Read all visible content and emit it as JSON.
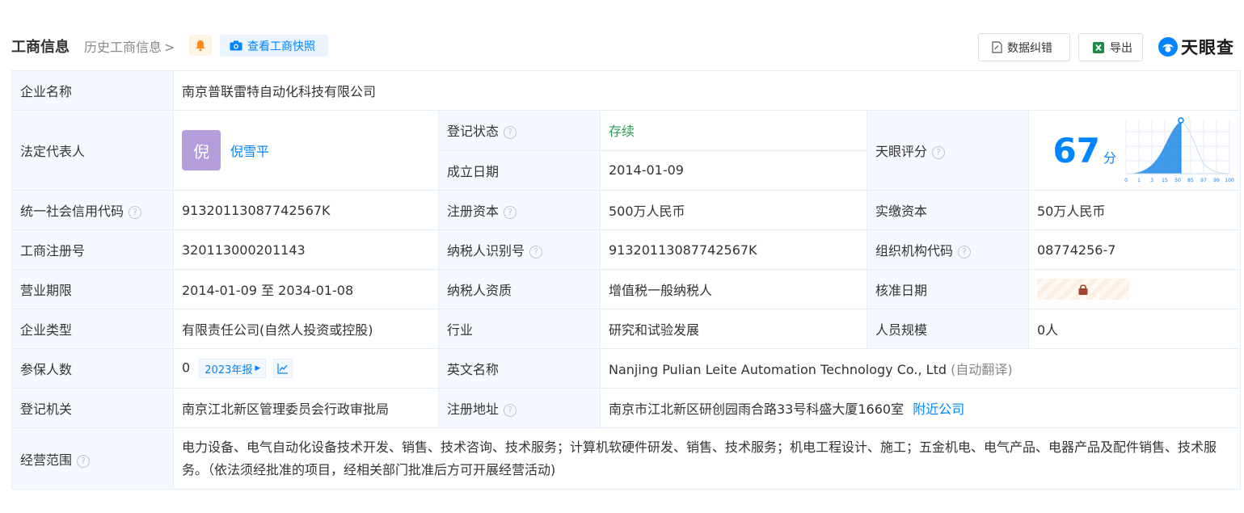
{
  "header": {
    "title": "工商信息",
    "history": "历史工商信息",
    "snapshot_btn": "查看工商快照",
    "fix_btn": "数据纠错",
    "export_btn": "导出",
    "brand": "天眼查"
  },
  "rows": {
    "company_name": {
      "label": "企业名称",
      "value": "南京普联雷特自动化科技有限公司"
    },
    "legal_rep": {
      "label": "法定代表人",
      "avatar": "倪",
      "name": "倪雪平"
    },
    "reg_status": {
      "label": "登记状态",
      "value": "存续"
    },
    "found_date": {
      "label": "成立日期",
      "value": "2014-01-09"
    },
    "tianyan_score": {
      "label": "天眼评分",
      "score": "67",
      "unit": "分",
      "ticks": [
        "0",
        "1",
        "3",
        "15",
        "50",
        "85",
        "97",
        "99",
        "100"
      ],
      "color": "#0084ff"
    },
    "credit_code": {
      "label": "统一社会信用代码",
      "value": "91320113087742567K"
    },
    "reg_capital": {
      "label": "注册资本",
      "value": "500万人民币"
    },
    "paid_capital": {
      "label": "实缴资本",
      "value": "50万人民币"
    },
    "reg_no": {
      "label": "工商注册号",
      "value": "320113000201143"
    },
    "taxpayer_id": {
      "label": "纳税人识别号",
      "value": "91320113087742567K"
    },
    "org_code": {
      "label": "组织机构代码",
      "value": "08774256-7"
    },
    "biz_term": {
      "label": "营业期限",
      "value": "2014-01-09 至 2034-01-08"
    },
    "taxpayer_qual": {
      "label": "纳税人资质",
      "value": "增值税一般纳税人"
    },
    "approval_date": {
      "label": "核准日期"
    },
    "company_type": {
      "label": "企业类型",
      "value": "有限责任公司(自然人投资或控股)"
    },
    "industry": {
      "label": "行业",
      "value": "研究和试验发展"
    },
    "staff_size": {
      "label": "人员规模",
      "value": "0人"
    },
    "insured": {
      "label": "参保人数",
      "value": "0",
      "year_btn": "2023年报"
    },
    "english_name": {
      "label": "英文名称",
      "value": "Nanjing Pulian Leite Automation Technology Co., Ltd",
      "note": "(自动翻译)"
    },
    "reg_authority": {
      "label": "登记机关",
      "value": "南京江北新区管理委员会行政审批局"
    },
    "reg_address": {
      "label": "注册地址",
      "value": "南京市江北新区研创园雨合路33号科盛大厦1660室",
      "link": "附近公司"
    },
    "biz_scope": {
      "label": "经营范围",
      "value": "电力设备、电气自动化设备技术开发、销售、技术咨询、技术服务；计算机软硬件研发、销售、技术服务；机电工程设计、施工；五金机电、电气产品、电器产品及配件销售、技术服务。（依法须经批准的项目，经相关部门批准后方可开展经营活动)"
    }
  }
}
